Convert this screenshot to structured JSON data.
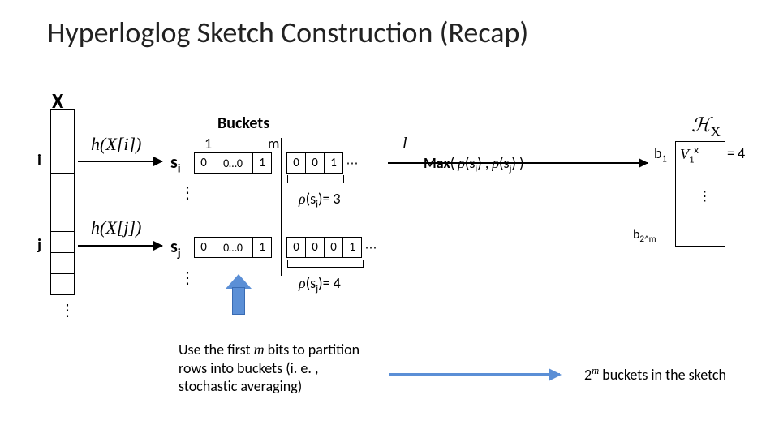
{
  "title": "Hyperloglog Sketch Construction (Recap)",
  "x_label": "X",
  "i_label": "i",
  "j_label": "j",
  "hash_xi": "h(X[i])",
  "hash_xj": "h(X[j])",
  "s_i": "sᵢ",
  "s_j": "sⱼ",
  "buckets_label": "Buckets",
  "one_label": "1",
  "m_label": "m",
  "l_label": "l",
  "row_i": {
    "b0": "0",
    "b1": "0…0",
    "b2": "1",
    "c0": "0",
    "c1": "0",
    "c2": "1",
    "dots": "⋯"
  },
  "row_j": {
    "b0": "0",
    "b1": "0…0",
    "b2": "1",
    "c0": "0",
    "c1": "0",
    "c2": "0",
    "c3": "1",
    "dots": "⋯"
  },
  "rho_si": "ρ(sᵢ)= 3",
  "rho_sj": "ρ(sⱼ)= 4",
  "max_label": "Max( ρ(sᵢ) , ρ(sⱼ) )",
  "hx_label": "ℋ_X",
  "b1_label": "b₁",
  "b2m_label": "b_{2^m}",
  "v1_eq": "V₁ˣ = 4",
  "footnote": "Use the first m bits to partition rows into buckets (i. e. , stochastic averaging)",
  "footnote2": "2ᵐ buckets in the sketch",
  "x_vdots": "⋮",
  "s_vdots": "⋮",
  "hx_vdots": "⋮"
}
